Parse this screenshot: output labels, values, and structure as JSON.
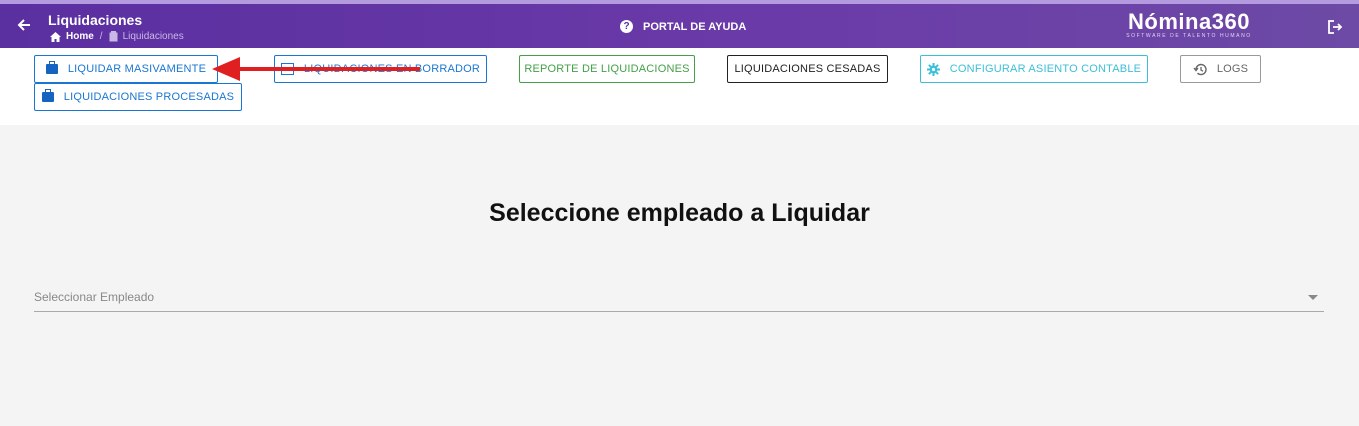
{
  "header": {
    "title": "Liquidaciones",
    "breadcrumb": {
      "home": "Home",
      "current": "Liquidaciones"
    },
    "help_label": "PORTAL DE AYUDA",
    "logo": {
      "name": "Nómina360",
      "tagline": "SOFTWARE DE TALENTO HUMANO"
    }
  },
  "toolbar": {
    "liquidar_masivamente": "LIQUIDAR MASIVAMENTE",
    "liquidaciones_borrador": "LIQUIDACIONES EN BORRADOR",
    "reporte": "REPORTE DE LIQUIDACIONES",
    "cesadas": "LIQUIDACIONES CESADAS",
    "configurar": "CONFIGURAR ASIENTO CONTABLE",
    "logs": "LOGS",
    "procesadas": "LIQUIDACIONES PROCESADAS"
  },
  "main": {
    "heading": "Seleccione empleado a Liquidar",
    "employee_select_placeholder": "Seleccionar Empleado"
  },
  "colors": {
    "header_bg": "#5a2fa0",
    "primary": "#1976d2",
    "success": "#43a047",
    "info": "#3bbfd8",
    "annotation_arrow": "#e02020"
  }
}
